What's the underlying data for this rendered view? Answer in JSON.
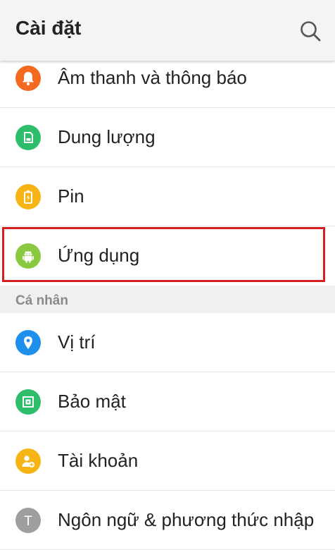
{
  "appbar": {
    "title": "Cài đặt",
    "search_icon": "search-icon"
  },
  "items_top": [
    {
      "label": "Âm thanh và thông báo",
      "icon": "bell-icon",
      "color": "#F26A21"
    },
    {
      "label": "Dung lượng",
      "icon": "storage-icon",
      "color": "#2EBD6B"
    },
    {
      "label": "Pin",
      "icon": "battery-icon",
      "color": "#F7B515"
    },
    {
      "label": "Ứng dụng",
      "icon": "android-icon",
      "color": "#8BC940",
      "highlighted": true
    }
  ],
  "section": {
    "title": "Cá nhân"
  },
  "items_personal": [
    {
      "label": "Vị trí",
      "icon": "location-pin-icon",
      "color": "#1E8FEB"
    },
    {
      "label": "Bảo mật",
      "icon": "security-icon",
      "color": "#2EBD6B"
    },
    {
      "label": "Tài khoản",
      "icon": "account-add-icon",
      "color": "#F7B515"
    },
    {
      "label": "Ngôn ngữ & phương thức nhập",
      "icon": "language-icon",
      "color": "#9E9E9E",
      "glyph": "T"
    }
  ],
  "colors": {
    "highlight_border": "#D42020",
    "section_background": "#F0F0F0",
    "appbar_background": "#F4F4F4"
  }
}
